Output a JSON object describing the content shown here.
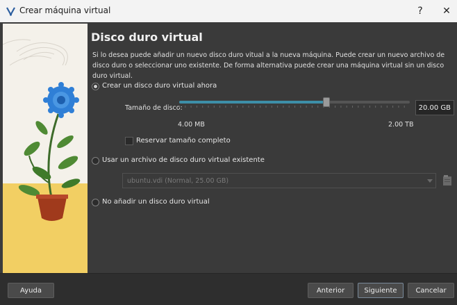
{
  "window": {
    "title": "Crear máquina virtual",
    "help_glyph": "?",
    "close_glyph": "✕"
  },
  "page": {
    "title": "Disco duro virtual",
    "description": "Si lo desea puede añadir un nuevo disco duro vitual a la nueva máquina. Puede crear un nuevo archivo de disco duro o seleccionar uno existente. De forma alternativa puede crear una máquina virtual sin un disco duro virtual."
  },
  "options": {
    "create_new": {
      "label": "Crear un disco duro virtual ahora",
      "checked": true
    },
    "use_existing": {
      "label": "Usar un archivo de disco duro virtual existente",
      "checked": false
    },
    "no_disk": {
      "label": "No añadir un disco duro virtual",
      "checked": false
    }
  },
  "disk_size": {
    "label": "Tamaño de disco:",
    "value": "20.00 GB",
    "min_label": "4.00 MB",
    "max_label": "2.00 TB",
    "slider_fraction": 0.64
  },
  "preallocate": {
    "label": "Reservar tamaño completo",
    "checked": false
  },
  "existing_file": {
    "selected": "ubuntu.vdi (Normal, 25.00 GB)",
    "enabled": false
  },
  "footer": {
    "help_label": "Ayuda",
    "back_label": "Anterior",
    "next_label": "Siguiente",
    "cancel_label": "Cancelar"
  },
  "colors": {
    "accent": "#3d8fa8",
    "panel": "#3a3a3a",
    "titlebar": "#f3f3f3",
    "flower": "#2f7fd6",
    "pot": "#a03a1c"
  },
  "icons": {
    "app": "virtualbox-icon",
    "folder": "folder-browse-icon"
  }
}
